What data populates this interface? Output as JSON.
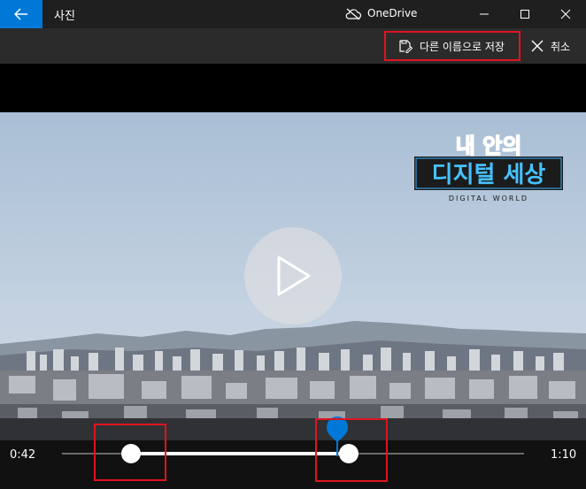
{
  "window": {
    "app_title": "사진",
    "cloud_label": "OneDrive",
    "minimize_glyph": "—",
    "maximize_glyph": "☐",
    "close_glyph": "✕"
  },
  "toolbar": {
    "save_as_label": "다른 이름으로 저장",
    "cancel_label": "취소"
  },
  "video": {
    "logo_title": "내 안의 디지털 세상",
    "logo_subtitle": "DIGITAL WORLD"
  },
  "timeline": {
    "current_time": "0:42",
    "end_time": "1:10",
    "trim_start_fraction": 0.149,
    "trim_end_fraction": 0.621,
    "playhead_fraction": 0.596
  },
  "colors": {
    "accent": "#0078d7",
    "highlight": "#e0141e"
  }
}
